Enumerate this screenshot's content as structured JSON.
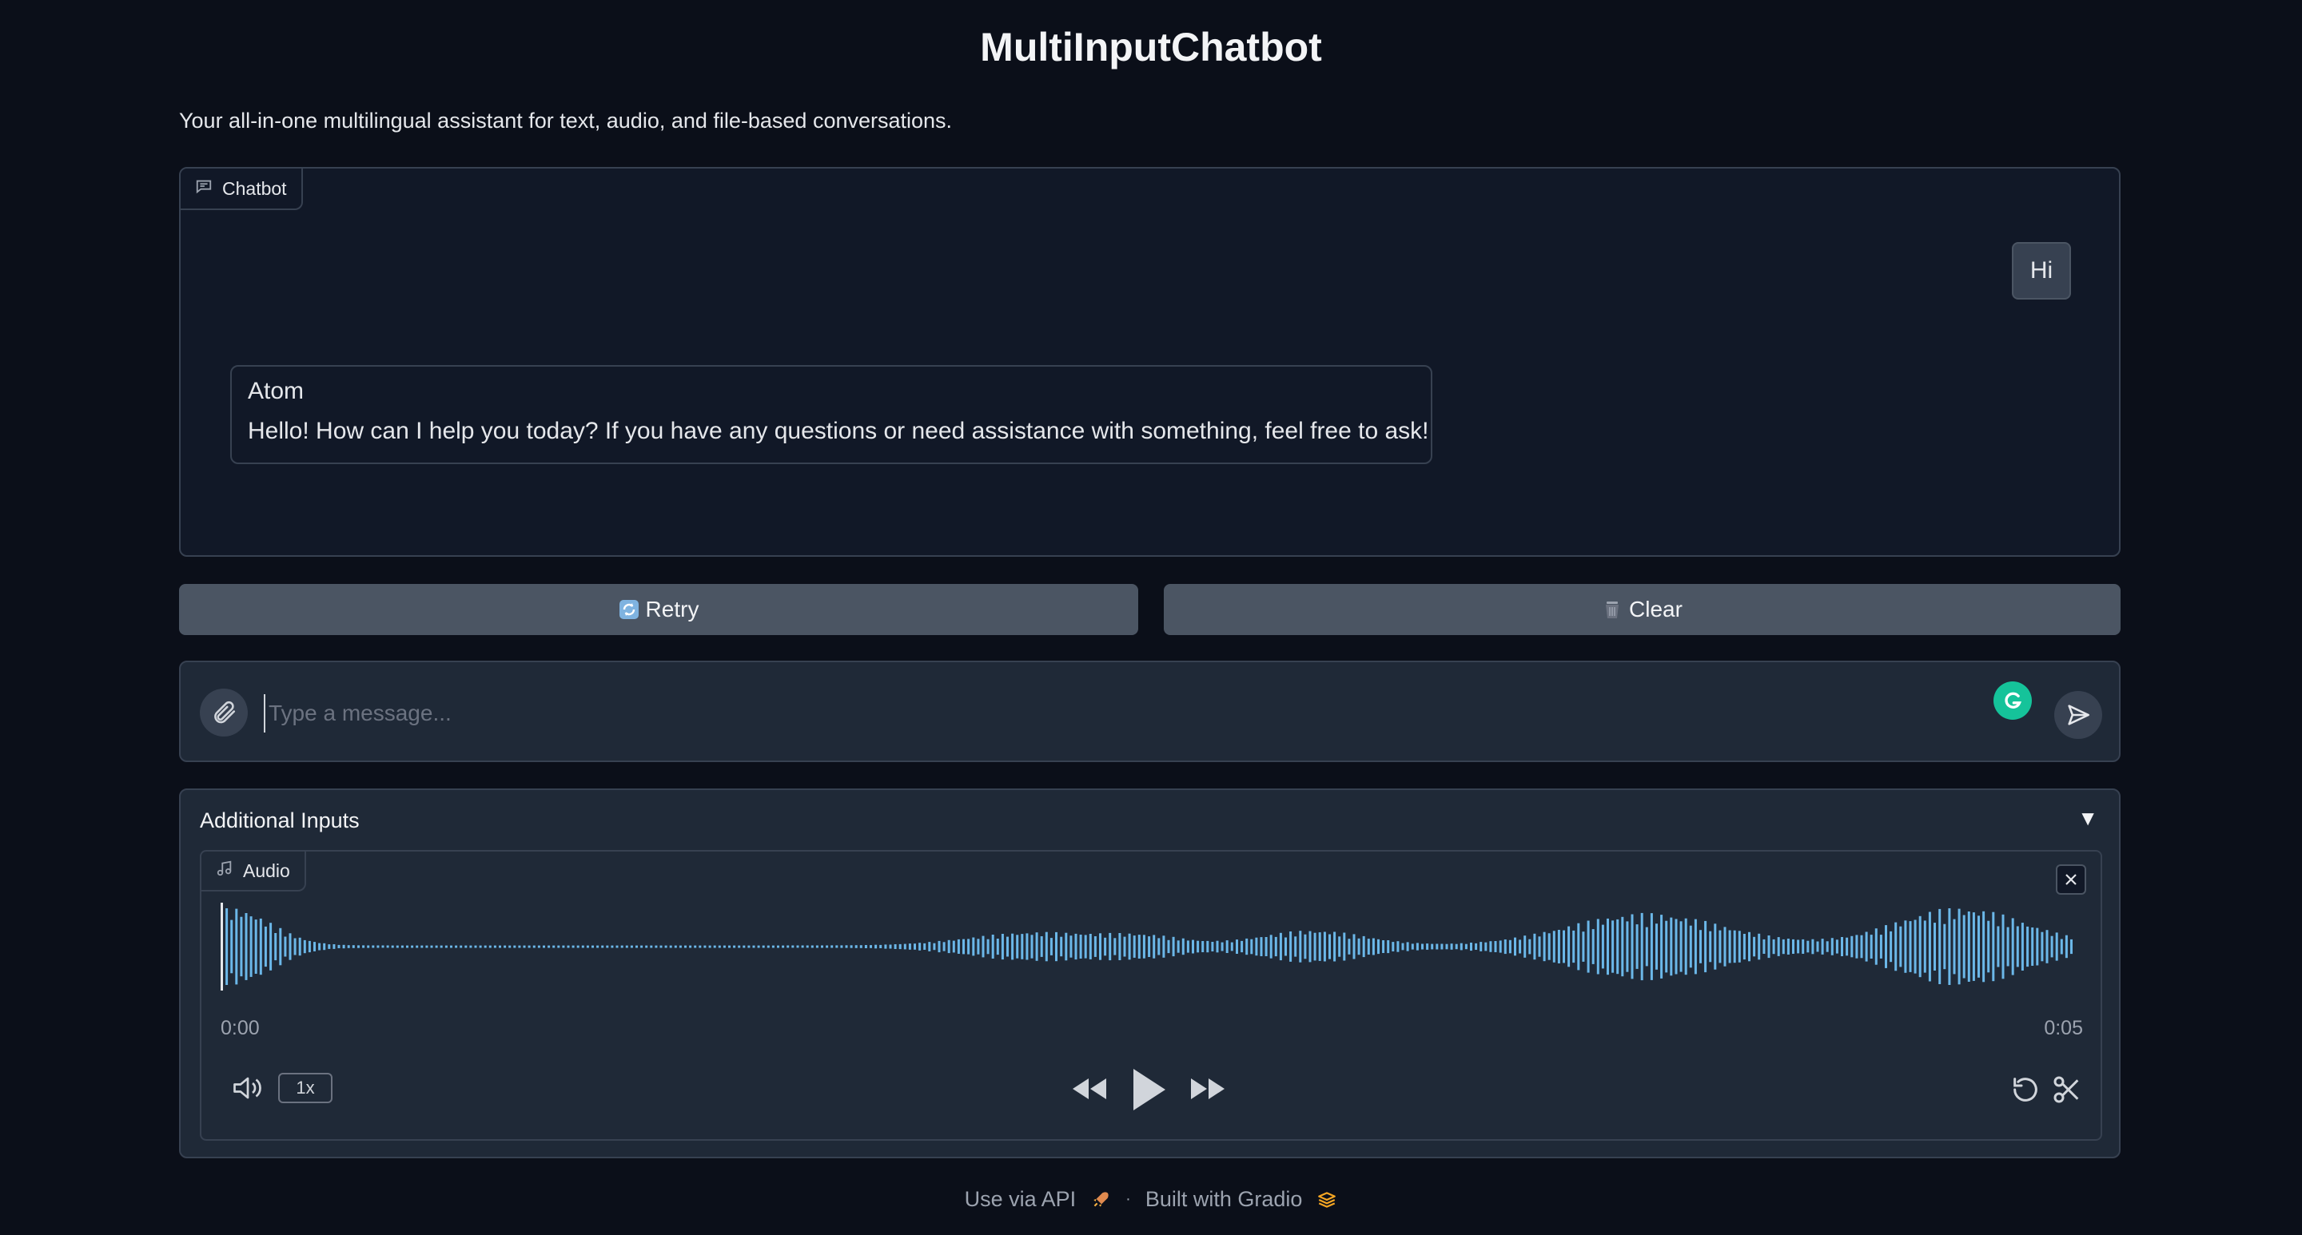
{
  "app": {
    "title": "MultiInputChatbot",
    "description": "Your all-in-one multilingual assistant for text, audio, and file-based conversations."
  },
  "chatbot": {
    "label": "Chatbot",
    "messages": [
      {
        "role": "user",
        "text": "Hi"
      },
      {
        "role": "assistant",
        "name": "Atom",
        "text": "Hello! How can I help you today? If you have any questions or need assistance with something, feel free to ask!"
      }
    ]
  },
  "buttons": {
    "retry_label": "Retry",
    "clear_label": "Clear"
  },
  "input": {
    "placeholder": "Type a message...",
    "value": ""
  },
  "additional_inputs": {
    "title": "Additional Inputs",
    "toggle": "▼",
    "audio": {
      "label": "Audio",
      "time_current": "0:00",
      "time_total": "0:05",
      "playback_speed": "1x",
      "wave_color": "#6bb7e8"
    }
  },
  "footer": {
    "api_link": "Use via API",
    "separator": "·",
    "built_with": "Built with Gradio"
  },
  "colors": {
    "background": "#0b0f19",
    "panel": "#111827",
    "border": "#374151",
    "button": "#4b5563"
  }
}
